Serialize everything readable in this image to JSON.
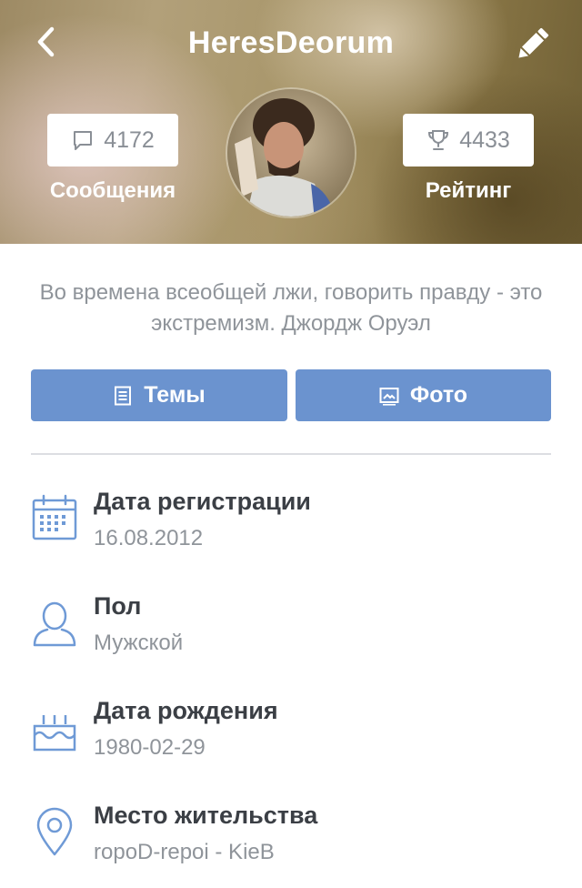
{
  "header": {
    "title": "HeresDeorum",
    "messages": {
      "count": "4172",
      "label": "Сообщения",
      "icon": "chat-bubble-icon"
    },
    "rating": {
      "count": "4433",
      "label": "Рейтинг",
      "icon": "trophy-icon"
    }
  },
  "quote": "Во времена всеобщей лжи, говорить правду - это экстремизм. Джордж Оруэл",
  "buttons": {
    "topics": "Темы",
    "photo": "Фото"
  },
  "info": [
    {
      "label": "Дата регистрации",
      "value": "16.08.2012",
      "icon": "calendar-icon"
    },
    {
      "label": "Пол",
      "value": "Мужской",
      "icon": "person-icon"
    },
    {
      "label": "Дата рождения",
      "value": "1980-02-29",
      "icon": "birthday-cake-icon"
    },
    {
      "label": "Место жительства",
      "value": "ropoD-repoi - KieB",
      "icon": "location-pin-icon"
    }
  ],
  "colors": {
    "accent": "#6b93cf",
    "icon_blue": "#6f9ad6"
  }
}
